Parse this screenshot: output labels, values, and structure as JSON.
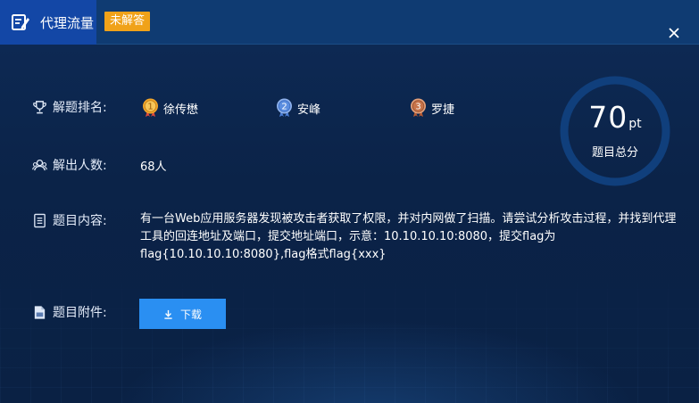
{
  "header": {
    "title": "代理流量",
    "status_badge": "未解答"
  },
  "labels": {
    "ranking": "解题排名:",
    "solvers": "解出人数:",
    "content": "题目内容:",
    "attachment": "题目附件:"
  },
  "ranking": [
    {
      "rank": "1",
      "name": "徐传懋",
      "color": "#f2a62b"
    },
    {
      "rank": "2",
      "name": "安峰",
      "color": "#5c8ee0"
    },
    {
      "rank": "3",
      "name": "罗捷",
      "color": "#c8744a"
    }
  ],
  "solvers_count": "68人",
  "content": "有一台Web应用服务器发现被攻击者获取了权限，并对内网做了扫描。请尝试分析攻击过程，并找到代理工具的回连地址及端口，提交地址端口，示意：10.10.10.10:8080，提交flag为flag{10.10.10.10:8080},flag格式flag{xxx}",
  "download_label": "下载",
  "score": {
    "value": "70",
    "unit": "pt",
    "caption": "题目总分"
  },
  "colors": {
    "badge": "#f0a219",
    "button": "#2a8ff2",
    "title_block": "#1347a6",
    "ring": "#103f7c"
  },
  "icons": {
    "title": "edit-document-icon",
    "close": "close-icon",
    "ranking": "trophy-icon",
    "solvers": "users-icon",
    "content": "document-icon",
    "attachment": "file-icon",
    "download": "download-icon"
  }
}
